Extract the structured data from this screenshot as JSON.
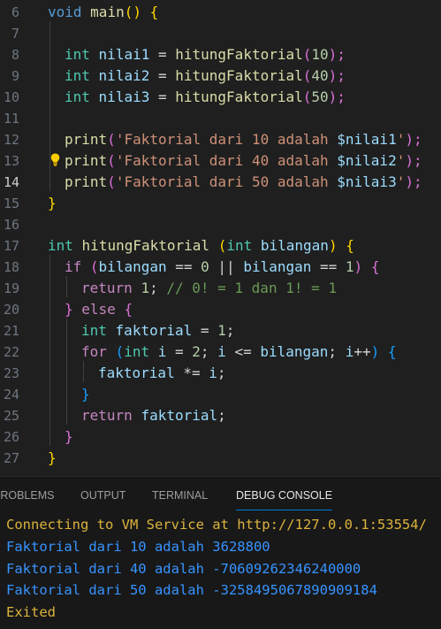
{
  "editor": {
    "current_line": "14",
    "lines": [
      {
        "n": "6",
        "t": [
          "void",
          " ",
          "main",
          "(",
          ")",
          " ",
          "{"
        ]
      },
      {
        "n": "7"
      },
      {
        "n": "8",
        "t": [
          "int",
          " ",
          "nilai1",
          " = ",
          "hitungFaktorial",
          "(",
          "10",
          ");"
        ]
      },
      {
        "n": "9",
        "t": [
          "int",
          " ",
          "nilai2",
          " = ",
          "hitungFaktorial",
          "(",
          "40",
          ");"
        ]
      },
      {
        "n": "10",
        "t": [
          "int",
          " ",
          "nilai3",
          " = ",
          "hitungFaktorial",
          "(",
          "50",
          ");"
        ]
      },
      {
        "n": "11"
      },
      {
        "n": "12",
        "t": [
          "print",
          "(",
          "'Faktorial dari 10 adalah ",
          "$nilai1",
          "'",
          ");"
        ]
      },
      {
        "n": "13",
        "t": [
          "print",
          "(",
          "'Faktorial dari 40 adalah ",
          "$nilai2",
          "'",
          ");"
        ]
      },
      {
        "n": "14",
        "t": [
          "print",
          "(",
          "'Faktorial dari 50 adalah ",
          "$nilai3",
          "'",
          ");"
        ]
      },
      {
        "n": "15",
        "t": [
          "}"
        ]
      },
      {
        "n": "16"
      },
      {
        "n": "17",
        "t": [
          "int",
          " ",
          "hitungFaktorial",
          " ",
          "(",
          "int",
          " ",
          "bilangan",
          ")",
          " ",
          "{"
        ]
      },
      {
        "n": "18",
        "t": [
          "if",
          " ",
          "(",
          "bilangan",
          " == ",
          "0",
          " || ",
          "bilangan",
          " == ",
          "1",
          ")",
          " ",
          "{"
        ]
      },
      {
        "n": "19",
        "t": [
          "return",
          " ",
          "1",
          "; ",
          "// 0! = 1 dan 1! = 1"
        ]
      },
      {
        "n": "20",
        "t": [
          "}",
          " ",
          "else",
          " ",
          "{"
        ]
      },
      {
        "n": "21",
        "t": [
          "int",
          " ",
          "faktorial",
          " = ",
          "1",
          ";"
        ]
      },
      {
        "n": "22",
        "t": [
          "for",
          " ",
          "(",
          "int",
          " ",
          "i",
          " = ",
          "2",
          "; ",
          "i",
          " <= ",
          "bilangan",
          "; ",
          "i",
          "++",
          ")",
          " ",
          "{"
        ]
      },
      {
        "n": "23",
        "t": [
          "faktorial",
          " *= ",
          "i",
          ";"
        ]
      },
      {
        "n": "24",
        "t": [
          "}"
        ]
      },
      {
        "n": "25",
        "t": [
          "return",
          " ",
          "faktorial",
          ";"
        ]
      },
      {
        "n": "26",
        "t": [
          "}"
        ]
      },
      {
        "n": "27",
        "t": [
          "}"
        ]
      }
    ]
  },
  "panel": {
    "tabs": [
      "PROBLEMS",
      "OUTPUT",
      "TERMINAL",
      "DEBUG CONSOLE"
    ],
    "active_tab": "DEBUG CONSOLE",
    "output": [
      "Connecting to VM Service at http://127.0.0.1:53554/",
      "Faktorial dari 10 adalah 3628800",
      "Faktorial dari 40 adalah -70609262346240000",
      "Faktorial dari 50 adalah -3258495067890909184",
      "Exited"
    ]
  },
  "icons": {
    "lightbulb": "lightbulb-icon"
  },
  "colors": {
    "accent": "#0078d4",
    "lightbulb": "#ffcc00",
    "output_info": "#3794ff",
    "output_status": "#dcb33c"
  }
}
